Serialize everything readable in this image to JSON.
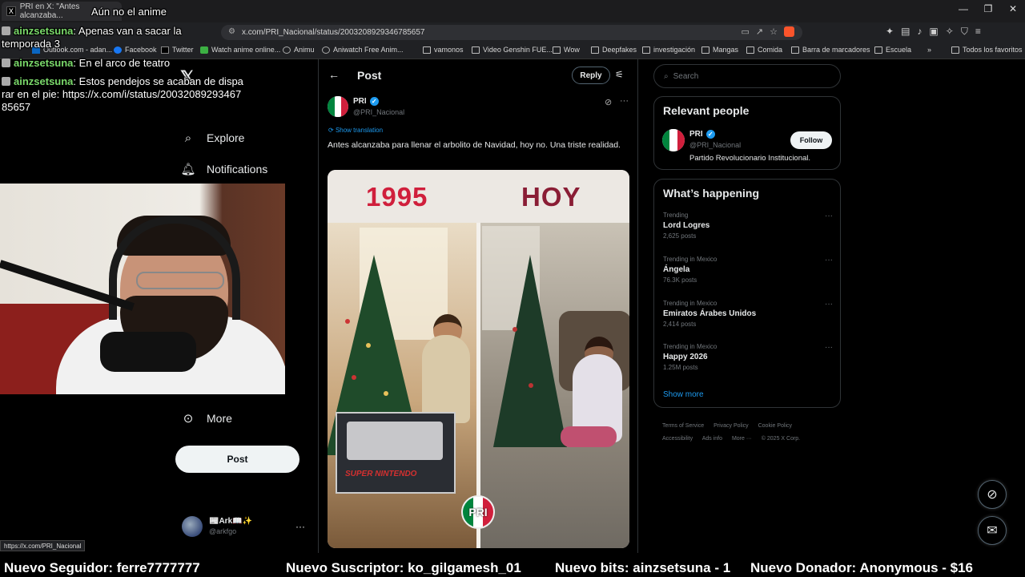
{
  "browser": {
    "tab_title": "PRI en X: \"Antes alcanzaba...",
    "url": "x.com/PRI_Nacional/status/2003208929346785657",
    "bookmarks": [
      "Outlook.com - adan...",
      "Facebook",
      "Twitter",
      "Watch anime online...",
      "Animu",
      "Aniwatch Free Anim...",
      "vamonos",
      "Video Genshin FUE...",
      "Wow",
      "Deepfakes",
      "investigación",
      "Mangas",
      "Comida",
      "Barra de marcadores",
      "Escuela"
    ],
    "all_bookmarks": "Todos los favoritos",
    "status_url": "https://x.com/PRI_Nacional"
  },
  "nav": {
    "explore": "Explore",
    "notifications": "Notifications",
    "more": "More",
    "post_button": "Post",
    "account_name": "📰Ark📖✨",
    "account_handle": "@arkfgo"
  },
  "post": {
    "header_title": "Post",
    "reply_label": "Reply",
    "author_name": "PRI",
    "author_handle": "@PRI_Nacional",
    "show_translation": "Show translation",
    "text": "Antes alcanzaba para llenar el arbolito de Navidad, hoy no. Una triste realidad.",
    "image": {
      "left_label": "1995",
      "right_label": "HOY",
      "console_text": "SUPER NINTENDO",
      "logo_text": "PRI"
    }
  },
  "sidebar": {
    "search_placeholder": "Search",
    "relevant_title": "Relevant people",
    "person": {
      "name": "PRI",
      "handle": "@PRI_Nacional",
      "bio": "Partido Revolucionario Institucional.",
      "follow_label": "Follow"
    },
    "happening_title": "What’s happening",
    "trends": [
      {
        "context": "Trending",
        "name": "Lord Logres",
        "count": "2,625 posts"
      },
      {
        "context": "Trending in Mexico",
        "name": "Ángela",
        "count": "76.3K posts"
      },
      {
        "context": "Trending in Mexico",
        "name": "Emiratos Árabes Unidos",
        "count": "2,414 posts"
      },
      {
        "context": "Trending in Mexico",
        "name": "Happy 2026",
        "count": "1.25M posts"
      }
    ],
    "show_more": "Show more",
    "footer": [
      "Terms of Service",
      "Privacy Policy",
      "Cookie Policy",
      "Accessibility",
      "Ads info",
      "More ···",
      "© 2025 X Corp."
    ]
  },
  "stream": {
    "chat": [
      {
        "user": "",
        "text": "Aún no el anime"
      },
      {
        "user": "ainzsetsuna",
        "text": ": Apenas van a sacar la temporada 3"
      },
      {
        "user": "ainzsetsuna",
        "text": ": En el arco de teatro"
      },
      {
        "user": "ainzsetsuna",
        "text": ": Estos pendejos se acaban de disparar en el pie: https://x.com/i/status/2003208929346785657"
      }
    ],
    "ticker": [
      "Nuevo Seguidor: ferre7777777",
      "Nuevo Suscriptor: ko_gilgamesh_01",
      "Nuevo bits: ainzsetsuna - 1",
      "Nuevo Donador: Anonymous - $16"
    ]
  },
  "colors": {
    "x_blue": "#1d9bf0",
    "pri_green": "#00843d",
    "pri_red": "#d01f3c",
    "chat_user": "#7ad96a"
  }
}
